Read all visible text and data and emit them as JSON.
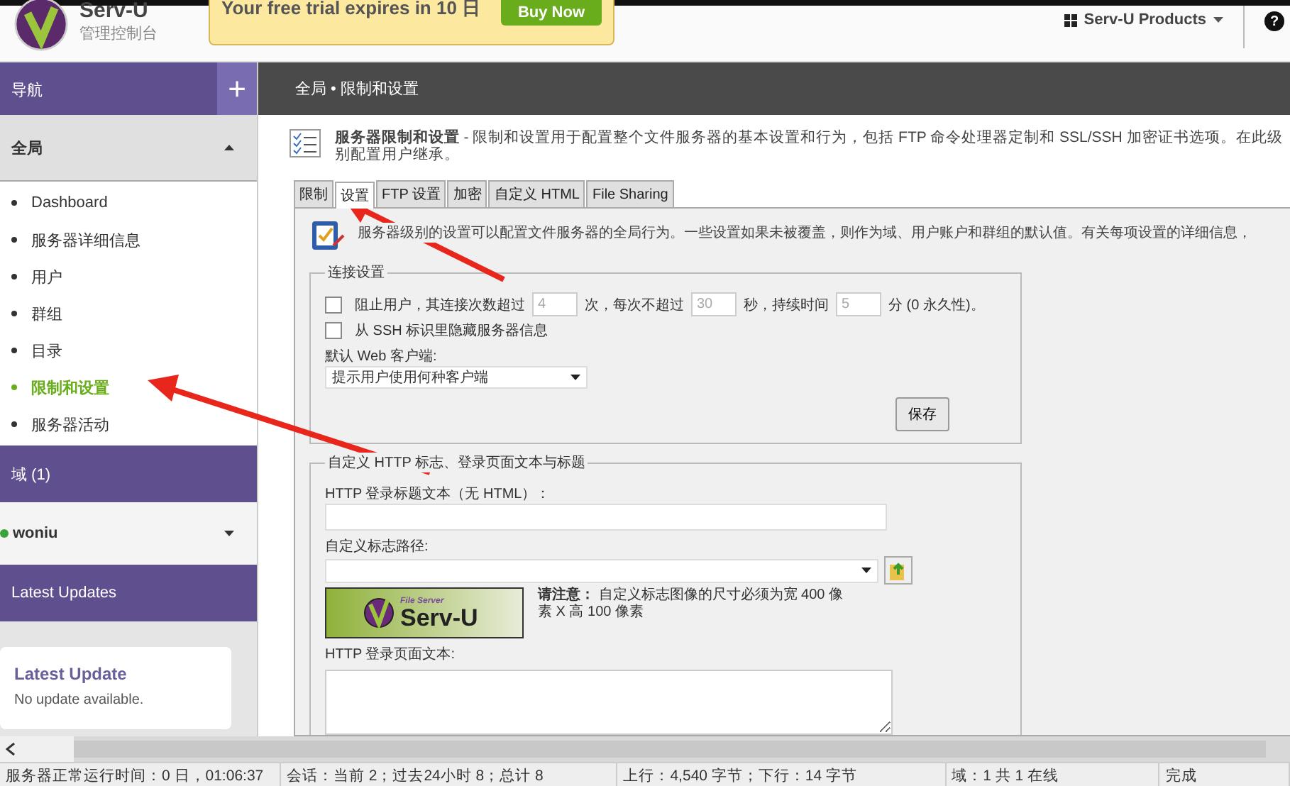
{
  "header": {
    "app_name": "Serv-U",
    "subtitle": "管理控制台",
    "trial_banner": {
      "text": "Your free trial expires in 10 日",
      "button": "Buy Now"
    },
    "products_menu": "Serv-U Products",
    "help": "?"
  },
  "sidebar": {
    "nav_title": "导航",
    "add": "+",
    "section": {
      "label": "全局",
      "expanded": true
    },
    "items": [
      {
        "label": "Dashboard",
        "selected": false
      },
      {
        "label": "服务器详细信息",
        "selected": false
      },
      {
        "label": "用户",
        "selected": false
      },
      {
        "label": "群组",
        "selected": false
      },
      {
        "label": "目录",
        "selected": false
      },
      {
        "label": "限制和设置",
        "selected": true
      },
      {
        "label": "服务器活动",
        "selected": false
      }
    ],
    "domains_title": "域 (1)",
    "domain": {
      "name": "woniu",
      "expanded": false
    },
    "updates_title": "Latest Updates",
    "update_card": {
      "title": "Latest Update",
      "text": "No update available."
    }
  },
  "breadcrumb": "全局 • 限制和设置",
  "page_description": "**服务器限制和设置** - 限制和设置用于配置整个文件服务器的基本设置和行为，包括 FTP 命令处理器定制和 SSL/SSH 加密证书选项。在此级别配置用户继承。",
  "tabs": [
    {
      "label": "限制",
      "selected": false
    },
    {
      "label": "设置",
      "selected": true
    },
    {
      "label": "FTP 设置",
      "selected": false
    },
    {
      "label": "加密",
      "selected": false
    },
    {
      "label": "自定义 HTML",
      "selected": false
    },
    {
      "label": "File Sharing",
      "selected": false
    }
  ],
  "settings_intro": "服务器级别的设置可以配置文件服务器的全局行为。一些设置如果未被覆盖，则作为域、用户账户和群组的默认值。有关每项设置的详细信息，",
  "connection": {
    "legend": "连接设置",
    "block_users": {
      "checked": false,
      "parts": [
        {
          "kind": "text",
          "text": "阻止用户，其连接次数超过"
        },
        {
          "kind": "input",
          "value": "4",
          "disabled": true
        },
        {
          "kind": "text",
          "text": "次，每次不超过"
        },
        {
          "kind": "input",
          "value": "30",
          "disabled": true
        },
        {
          "kind": "text",
          "text": "秒，持续时间"
        },
        {
          "kind": "input",
          "value": "5",
          "disabled": true
        },
        {
          "kind": "text",
          "text": "分 (0 永久性)。"
        }
      ]
    },
    "hide_ssh": {
      "checked": false,
      "label": "从 SSH 标识里隐藏服务器信息"
    },
    "web_client_label": "默认 Web 客户端:",
    "web_client_value": "提示用户使用何种客户端",
    "save": "保存"
  },
  "custom_http": {
    "legend": "自定义 HTTP 标志、登录页面文本与标题",
    "title_label": "HTTP 登录标题文本（无 HTML）：",
    "logo_path_label": "自定义标志路径:",
    "logo_preview": {
      "caption": "File Server",
      "name": "Serv-U"
    },
    "note": "**请注意：** 自定义标志图像的尺寸必须为宽 400 像素 X 高 100 像素",
    "page_text_label": "HTTP 登录页面文本:"
  },
  "status_bar": [
    "服务器正常运行时间：0 日，01:06:37",
    "会话：当前 2；过去24小时 8；总计 8",
    "上行：4,540 字节；下行：14 字节",
    "域：1 共 1 在线",
    "完成"
  ]
}
